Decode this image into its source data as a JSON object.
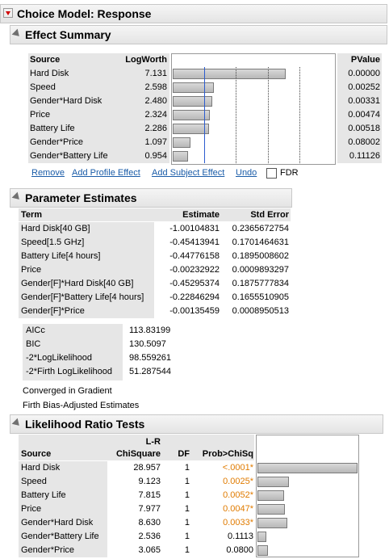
{
  "report": {
    "title": "Choice Model: Response"
  },
  "effect_summary": {
    "title": "Effect Summary",
    "headers": {
      "source": "Source",
      "logworth": "LogWorth",
      "pvalue": "PValue"
    },
    "rows": [
      {
        "source": "Hard Disk",
        "logworth": "7.131",
        "pvalue": "0.00000",
        "value": 7.131
      },
      {
        "source": "Speed",
        "logworth": "2.598",
        "pvalue": "0.00252",
        "value": 2.598
      },
      {
        "source": "Gender*Hard Disk",
        "logworth": "2.480",
        "pvalue": "0.00331",
        "value": 2.48
      },
      {
        "source": "Price",
        "logworth": "2.324",
        "pvalue": "0.00474",
        "value": 2.324
      },
      {
        "source": "Battery Life",
        "logworth": "2.286",
        "pvalue": "0.00518",
        "value": 2.286
      },
      {
        "source": "Gender*Price",
        "logworth": "1.097",
        "pvalue": "0.08002",
        "value": 1.097
      },
      {
        "source": "Gender*Battery Life",
        "logworth": "0.954",
        "pvalue": "0.11126",
        "value": 0.954
      }
    ],
    "bar_max": 10,
    "reference_line": 2,
    "actions": {
      "remove": "Remove",
      "add_profile": "Add Profile Effect",
      "add_subject": "Add Subject Effect",
      "undo": "Undo",
      "fdr": "FDR"
    }
  },
  "parameter_estimates": {
    "title": "Parameter Estimates",
    "headers": {
      "term": "Term",
      "estimate": "Estimate",
      "std_error": "Std Error"
    },
    "rows": [
      {
        "term": "Hard Disk[40 GB]",
        "estimate": "-1.00104831",
        "std_error": "0.2365672754"
      },
      {
        "term": "Speed[1.5 GHz]",
        "estimate": "-0.45413941",
        "std_error": "0.1701464631"
      },
      {
        "term": "Battery Life[4 hours]",
        "estimate": "-0.44776158",
        "std_error": "0.1895008602"
      },
      {
        "term": "Price",
        "estimate": "-0.00232922",
        "std_error": "0.0009893297"
      },
      {
        "term": "Gender[F]*Hard Disk[40 GB]",
        "estimate": "-0.45295374",
        "std_error": "0.1875777834"
      },
      {
        "term": "Gender[F]*Battery Life[4 hours]",
        "estimate": "-0.22846294",
        "std_error": "0.1655510905"
      },
      {
        "term": "Gender[F]*Price",
        "estimate": "-0.00135459",
        "std_error": "0.0008950513"
      }
    ],
    "fit_stats": [
      {
        "label": "AICc",
        "value": "113.83199"
      },
      {
        "label": "BIC",
        "value": "130.5097"
      },
      {
        "label": "-2*LogLikelihood",
        "value": "98.559261"
      },
      {
        "label": "-2*Firth LogLikelihood",
        "value": "51.287544"
      }
    ],
    "notes": [
      "Converged in Gradient",
      "Firth Bias-Adjusted Estimates"
    ]
  },
  "likelihood_ratio": {
    "title": "Likelihood Ratio Tests",
    "headers": {
      "source": "Source",
      "lr_top": "L-R",
      "chisq": "ChiSquare",
      "df": "DF",
      "prob": "Prob>ChiSq"
    },
    "rows": [
      {
        "source": "Hard Disk",
        "chisq": "28.957",
        "df": "1",
        "prob": "<.0001*",
        "sig": true,
        "value": 28.957
      },
      {
        "source": "Speed",
        "chisq": "9.123",
        "df": "1",
        "prob": "0.0025*",
        "sig": true,
        "value": 9.123
      },
      {
        "source": "Battery Life",
        "chisq": "7.815",
        "df": "1",
        "prob": "0.0052*",
        "sig": true,
        "value": 7.815
      },
      {
        "source": "Price",
        "chisq": "7.977",
        "df": "1",
        "prob": "0.0047*",
        "sig": true,
        "value": 7.977
      },
      {
        "source": "Gender*Hard Disk",
        "chisq": "8.630",
        "df": "1",
        "prob": "0.0033*",
        "sig": true,
        "value": 8.63
      },
      {
        "source": "Gender*Battery Life",
        "chisq": "2.536",
        "df": "1",
        "prob": "0.1113",
        "sig": false,
        "value": 2.536
      },
      {
        "source": "Gender*Price",
        "chisq": "3.065",
        "df": "1",
        "prob": "0.0800",
        "sig": false,
        "value": 3.065
      }
    ],
    "bar_max": 28.957
  },
  "colors": {
    "significant": "#e07b00",
    "link": "#1a5ca8",
    "title_red": "#d00000"
  }
}
